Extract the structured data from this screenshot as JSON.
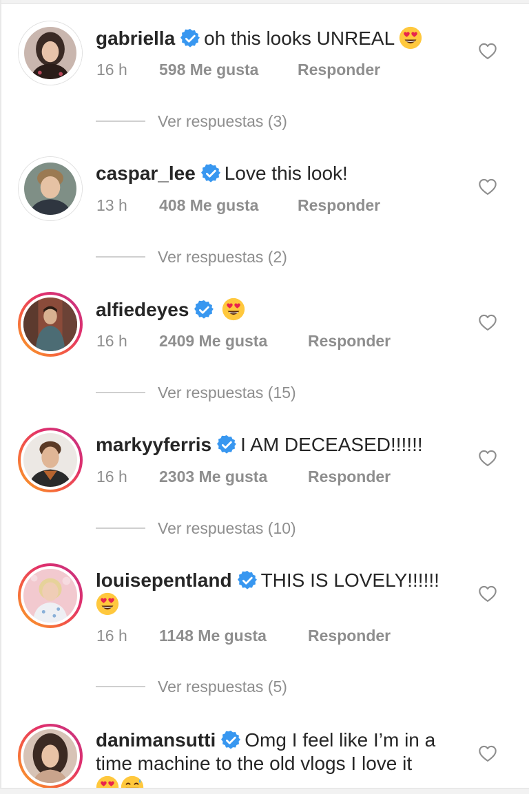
{
  "comments": [
    {
      "username": "gabriella",
      "verified": true,
      "text": "oh this looks UNREAL",
      "emoji": [
        "heart-eyes"
      ],
      "time": "16 h",
      "likes": "598 Me gusta",
      "reply_label": "Responder",
      "view_replies": "Ver respuestas (3)",
      "story_ring": false
    },
    {
      "username": "caspar_lee",
      "verified": true,
      "text": "Love this look!",
      "emoji": [],
      "time": "13 h",
      "likes": "408 Me gusta",
      "reply_label": "Responder",
      "view_replies": "Ver respuestas (2)",
      "story_ring": false
    },
    {
      "username": "alfiedeyes",
      "verified": true,
      "text": "",
      "emoji": [
        "heart-eyes"
      ],
      "time": "16 h",
      "likes": "2409 Me gusta",
      "reply_label": "Responder",
      "view_replies": "Ver respuestas (15)",
      "story_ring": true
    },
    {
      "username": "markyyferris",
      "verified": true,
      "text": "I AM DECEASED!!!!!!",
      "emoji": [],
      "time": "16 h",
      "likes": "2303 Me gusta",
      "reply_label": "Responder",
      "view_replies": "Ver respuestas (10)",
      "story_ring": true
    },
    {
      "username": "louisepentland",
      "verified": true,
      "text": "THIS IS LOVELY!!!!!!",
      "emoji": [
        "heart-eyes"
      ],
      "time": "16 h",
      "likes": "1148 Me gusta",
      "reply_label": "Responder",
      "view_replies": "Ver respuestas (5)",
      "story_ring": true
    },
    {
      "username": "danimansutti",
      "verified": true,
      "text_line1": "Omg I feel like I’m in a",
      "text_line2": "time machine to the old vlogs I love it",
      "emoji": [
        "heart-eyes",
        "grin-sweat"
      ],
      "story_ring": true
    }
  ],
  "colors": {
    "text": "#262626",
    "meta": "#8e8e8e",
    "verified_blue": "#3897f0",
    "story_ring": [
      "#f9a825",
      "#e1306c",
      "#c13584"
    ]
  },
  "icons": {
    "verified": "verified-badge-icon",
    "like": "heart-outline-icon",
    "emoji_heart_eyes": "heart-eyes-emoji",
    "emoji_grin_sweat": "grin-sweat-emoji"
  }
}
